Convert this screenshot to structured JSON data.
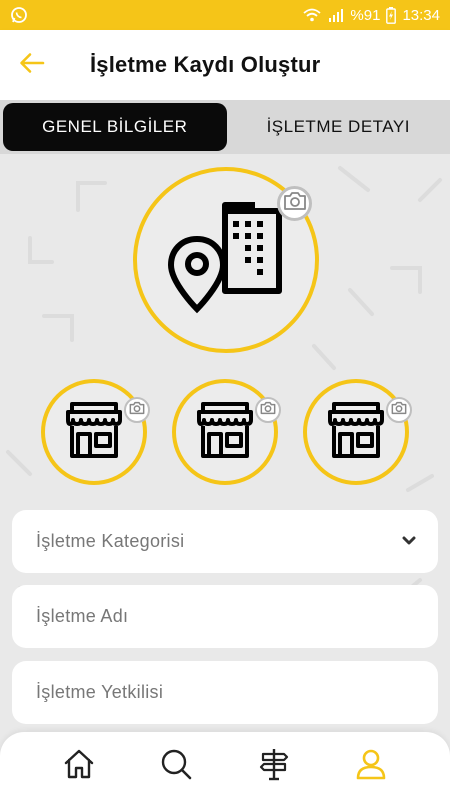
{
  "status_bar": {
    "battery": "%91",
    "time": "13:34",
    "icons": [
      "whatsapp-icon",
      "wifi-icon",
      "signal-icon",
      "battery-charging-icon"
    ]
  },
  "app_bar": {
    "title": "İşletme Kaydı Oluştur",
    "back_icon": "arrow-left-icon"
  },
  "tabs": [
    {
      "label": "GENEL BİLGİLER",
      "active": true
    },
    {
      "label": "İŞLETME DETAYI",
      "active": false
    }
  ],
  "photos": {
    "main_icon": "building-location-icon",
    "thumb_icon": "store-icon",
    "camera_icon": "camera-icon"
  },
  "form": {
    "category_placeholder": "İşletme Kategorisi",
    "name_placeholder": "İşletme Adı",
    "officer_placeholder": "İşletme Yetkilisi"
  },
  "bottom_nav": [
    {
      "icon": "home-icon",
      "active": false
    },
    {
      "icon": "search-icon",
      "active": false
    },
    {
      "icon": "signpost-icon",
      "active": false
    },
    {
      "icon": "user-icon",
      "active": true
    }
  ],
  "colors": {
    "accent": "#f5c518",
    "active_tab": "#0a0a0a",
    "background": "#e9e9e9"
  }
}
